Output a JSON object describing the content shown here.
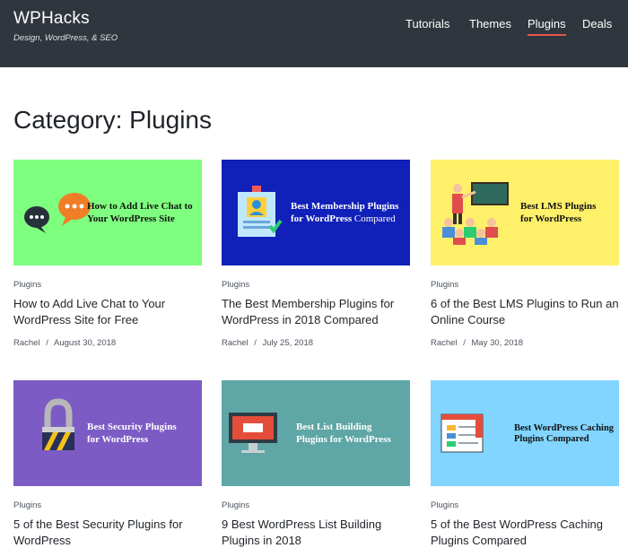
{
  "site": {
    "title": "WPHacks",
    "tagline": "Design, WordPress, & SEO"
  },
  "nav": {
    "items": [
      {
        "label": "Tutorials"
      },
      {
        "label": "Themes"
      },
      {
        "label": "Plugins"
      },
      {
        "label": "Deals"
      }
    ],
    "active": "Plugins"
  },
  "page": {
    "title": "Category: Plugins"
  },
  "posts": [
    {
      "thumb_text_line1": "How to Add Live Chat to",
      "thumb_text_line2": "Your WordPress Site",
      "category": "Plugins",
      "title": "How to Add Live Chat to Your WordPress Site for Free",
      "author": "Rachel",
      "separator": "/",
      "date": "August 30, 2018",
      "thumb_color": "#7fff7f"
    },
    {
      "thumb_text_line1": "Best Membership Plugins",
      "thumb_text_line2a": "for WordPress",
      "thumb_text_line2b": "Compared",
      "category": "Plugins",
      "title": "The Best Membership Plugins for WordPress in 2018 Compared",
      "author": "Rachel",
      "separator": "/",
      "date": "July 25, 2018",
      "thumb_color": "#1020b8"
    },
    {
      "thumb_text_line1": "Best LMS Plugins",
      "thumb_text_line2": "for WordPress",
      "category": "Plugins",
      "title": "6 of the Best LMS Plugins to Run an Online Course",
      "author": "Rachel",
      "separator": "/",
      "date": "May 30, 2018",
      "thumb_color": "#fff06a"
    },
    {
      "thumb_text_line1": "Best Security Plugins",
      "thumb_text_line2": "for WordPress",
      "category": "Plugins",
      "title": "5 of the Best Security Plugins for WordPress",
      "thumb_color": "#7c5cc4"
    },
    {
      "thumb_text_line1": "Best List Building",
      "thumb_text_line2": "Plugins for WordPress",
      "category": "Plugins",
      "title": "9 Best WordPress List Building Plugins in 2018",
      "thumb_color": "#5fa6a6"
    },
    {
      "thumb_text_line1": "Best WordPress Caching",
      "thumb_text_line2": "Plugins Compared",
      "category": "Plugins",
      "title": "5 of the Best WordPress Caching Plugins Compared",
      "thumb_color": "#82d5ff"
    }
  ]
}
